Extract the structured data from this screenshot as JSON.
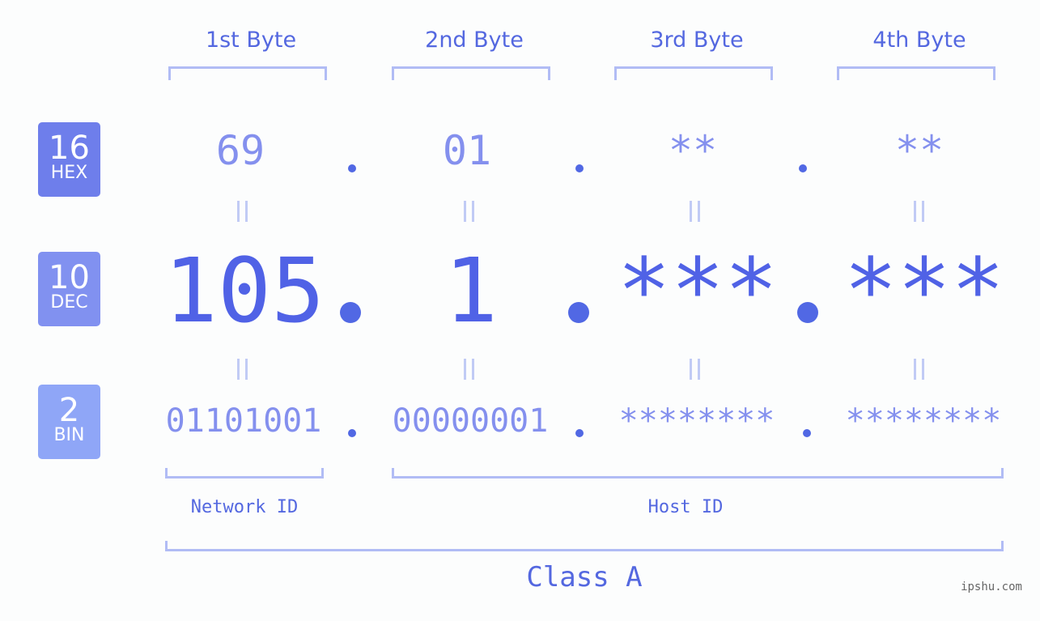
{
  "badges": [
    {
      "num": "16",
      "label": "HEX",
      "color": "#6e7eeb"
    },
    {
      "num": "10",
      "label": "DEC",
      "color": "#8191f0"
    },
    {
      "num": "2",
      "label": "BIN",
      "color": "#8fa6f7"
    }
  ],
  "headers": [
    "1st Byte",
    "2nd Byte",
    "3rd Byte",
    "4th Byte"
  ],
  "hex": [
    "69",
    "01",
    "**",
    "**"
  ],
  "dec": [
    "105",
    "1",
    "***",
    "***"
  ],
  "bin": [
    "01101001",
    "00000001",
    "********",
    "********"
  ],
  "network_label": "Network ID",
  "host_label": "Host ID",
  "class_label": "Class A",
  "watermark": "ipshu.com",
  "colors": {
    "accent": "#5468e0",
    "bracket": "#b1bcf5"
  }
}
